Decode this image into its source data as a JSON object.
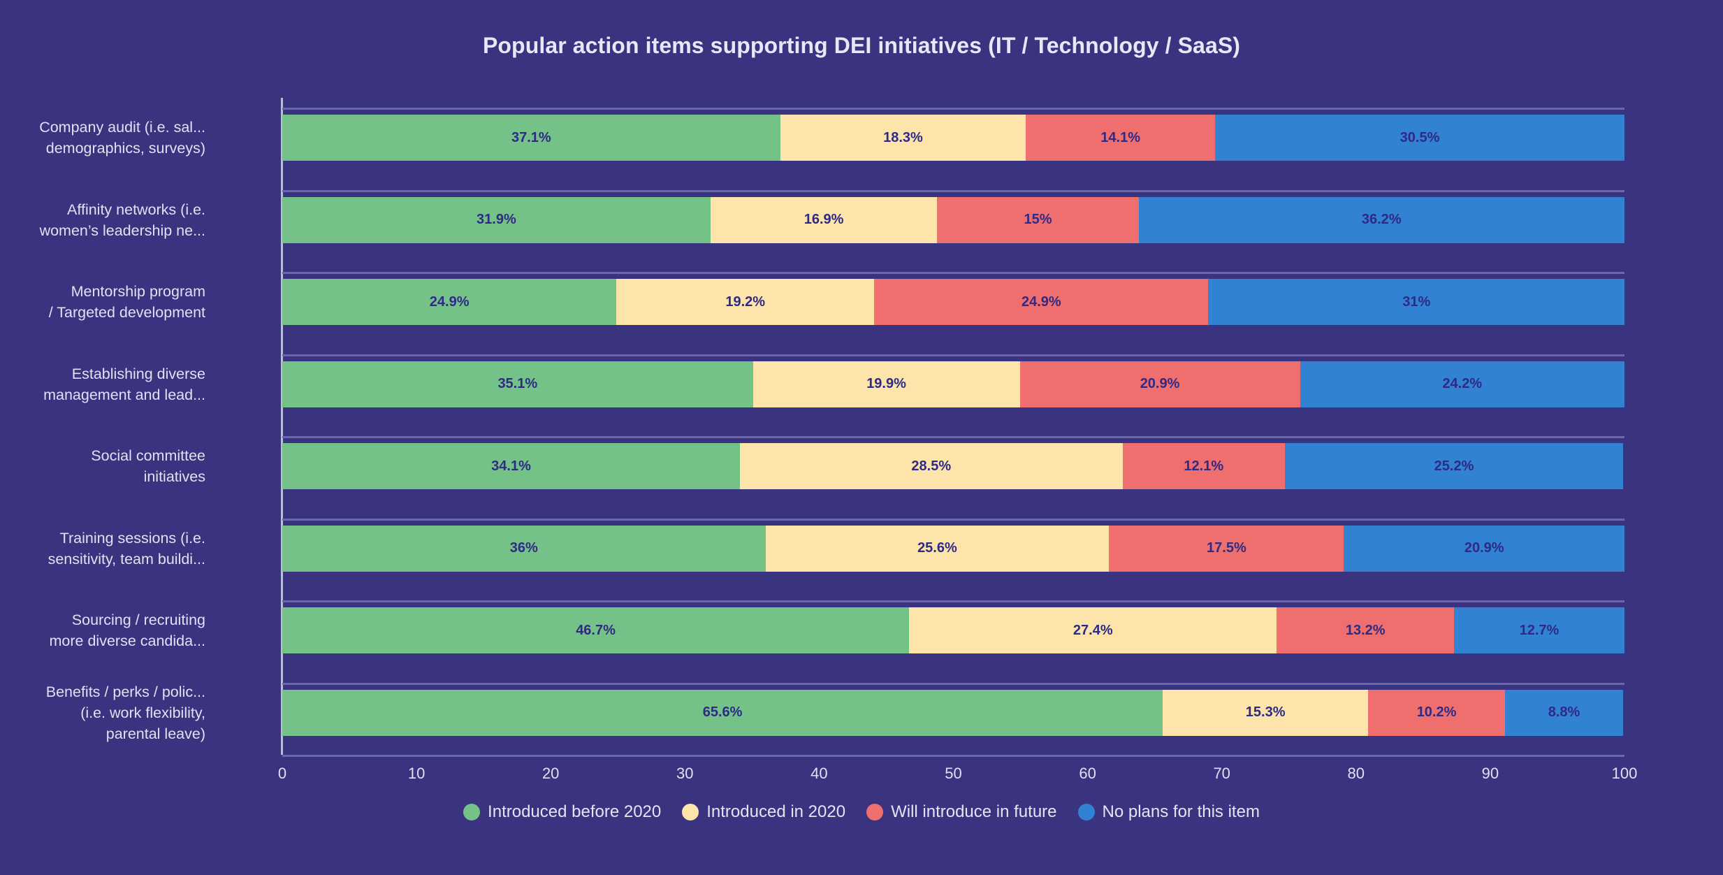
{
  "chart": {
    "title": "Popular action items supporting DEI initiatives (IT / Technology / SaaS)",
    "background_color": "#393380",
    "axis_color": "#6a68ab",
    "label_color": "#dfe2f2",
    "value_label_color": "#2e2a86"
  },
  "chart_data": {
    "type": "bar",
    "orientation": "horizontal",
    "stacked": true,
    "title": "Popular action items supporting DEI initiatives (IT / Technology / SaaS)",
    "xlabel": "",
    "ylabel": "",
    "xlim": [
      0,
      100
    ],
    "xticks": [
      "0",
      "10",
      "20",
      "30",
      "40",
      "50",
      "60",
      "70",
      "80",
      "90",
      "100"
    ],
    "grid": false,
    "legend_position": "bottom",
    "categories": [
      "Company audit (i.e. sal...\ndemographics, surveys)",
      "Affinity networks (i.e.\nwomen’s leadership ne...",
      "Mentorship program\n/ Targeted development",
      "Establishing diverse\nmanagement and lead...",
      "Social committee\ninitiatives",
      "Training sessions (i.e.\nsensitivity, team buildi...",
      "Sourcing / recruiting\nmore diverse candida...",
      "Benefits / perks / polic...\n(i.e. work flexibility,\nparental leave)"
    ],
    "series": [
      {
        "name": "Introduced before 2020",
        "color": "#74c287",
        "values": [
          37.1,
          31.9,
          24.9,
          35.1,
          34.1,
          36,
          46.7,
          65.6
        ],
        "labels": [
          "37.1%",
          "31.9%",
          "24.9%",
          "35.1%",
          "34.1%",
          "36%",
          "46.7%",
          "65.6%"
        ]
      },
      {
        "name": "Introduced in 2020",
        "color": "#fde4ab",
        "values": [
          18.3,
          16.9,
          19.2,
          19.9,
          28.5,
          25.6,
          27.4,
          15.3
        ],
        "labels": [
          "18.3%",
          "16.9%",
          "19.2%",
          "19.9%",
          "28.5%",
          "25.6%",
          "27.4%",
          "15.3%"
        ]
      },
      {
        "name": "Will introduce in future",
        "color": "#ef6e6e",
        "values": [
          14.1,
          15,
          24.9,
          20.9,
          12.1,
          17.5,
          13.2,
          10.2
        ],
        "labels": [
          "14.1%",
          "15%",
          "24.9%",
          "20.9%",
          "12.1%",
          "17.5%",
          "13.2%",
          "10.2%"
        ]
      },
      {
        "name": "No plans for this item",
        "color": "#3282d3",
        "values": [
          30.5,
          36.2,
          31,
          24.2,
          25.2,
          20.9,
          12.7,
          8.8
        ],
        "labels": [
          "30.5%",
          "36.2%",
          "31%",
          "24.2%",
          "25.2%",
          "20.9%",
          "12.7%",
          "8.8%"
        ]
      }
    ]
  },
  "legend": {
    "items": [
      {
        "label": "Introduced before 2020",
        "color": "#74c287"
      },
      {
        "label": "Introduced in 2020",
        "color": "#fde4ab"
      },
      {
        "label": "Will introduce in future",
        "color": "#ef6e6e"
      },
      {
        "label": "No plans for this item",
        "color": "#3282d3"
      }
    ]
  }
}
